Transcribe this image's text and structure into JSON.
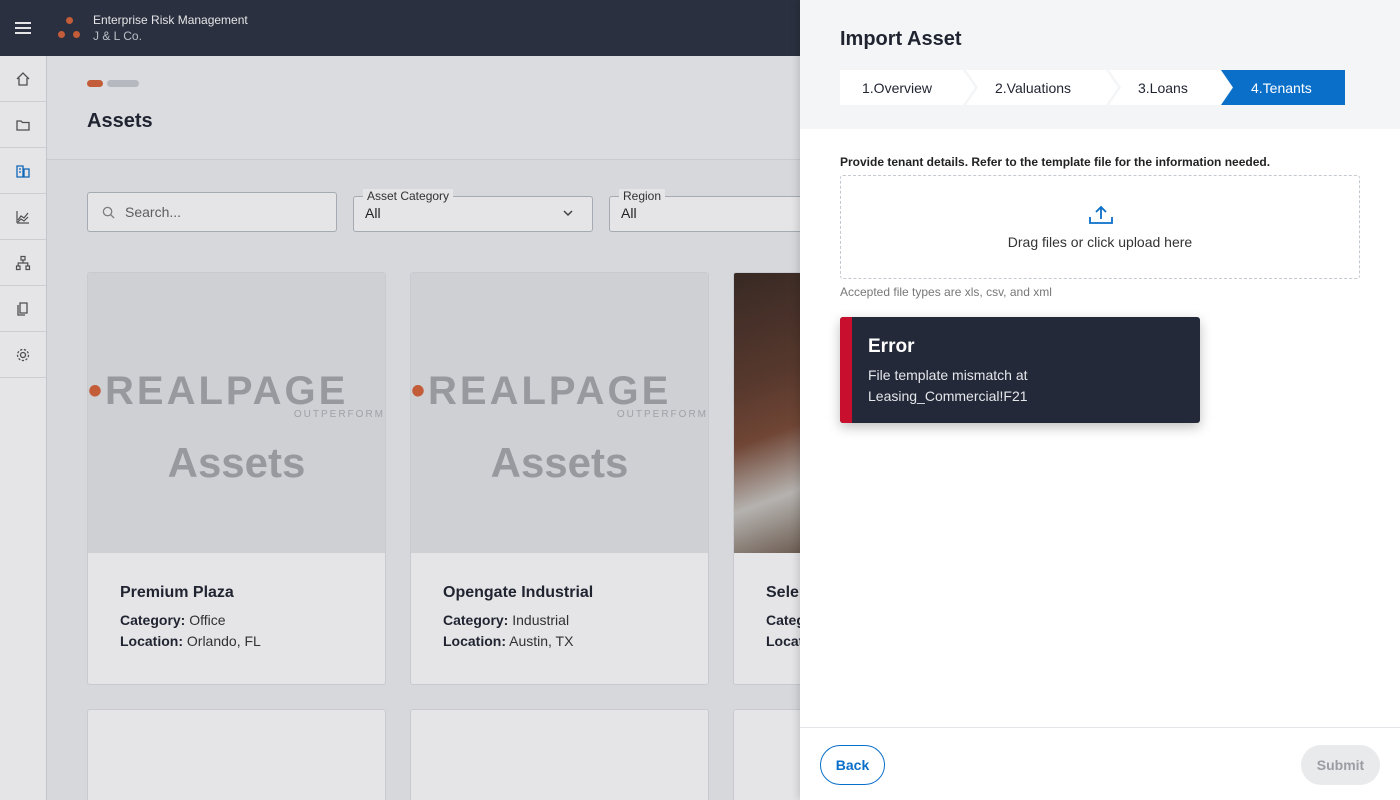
{
  "app": {
    "title": "Enterprise Risk Management",
    "subtitle": "J & L Co."
  },
  "colors": {
    "brand_dot": "#d9633a",
    "primary": "#0a6fc9",
    "error": "#c8102e",
    "topbar": "#2b3240"
  },
  "rail": {
    "icons": [
      "home-icon",
      "folder-icon",
      "assets-icon",
      "chart-icon",
      "hierarchy-icon",
      "documents-icon",
      "gear-icon"
    ]
  },
  "page": {
    "title": "Assets"
  },
  "filters": {
    "search_placeholder": "Search...",
    "asset_category": {
      "label": "Asset Category",
      "value": "All"
    },
    "region": {
      "label": "Region",
      "value": "All"
    }
  },
  "cards": [
    {
      "name": "Premium Plaza",
      "category_label": "Category:",
      "category": "Office",
      "location_label": "Location:",
      "location": "Orlando, FL",
      "image_brand": "REALPAGE",
      "image_sub": "OUTPERFORM",
      "image_caption": "Assets"
    },
    {
      "name": "Opengate Industrial",
      "category_label": "Category:",
      "category": "Industrial",
      "location_label": "Location:",
      "location": "Austin, TX",
      "image_brand": "REALPAGE",
      "image_sub": "OUTPERFORM",
      "image_caption": "Assets"
    },
    {
      "name": "Selen",
      "category_label": "Categ",
      "location_label": "Locat"
    }
  ],
  "drawer": {
    "title": "Import Asset",
    "steps": [
      "1.Overview",
      "2.Valuations",
      "3.Loans",
      "4.Tenants"
    ],
    "active_step": 3,
    "instructions": "Provide tenant details. Refer to the template file for the information needed.",
    "dropzone_text": "Drag files or click upload here",
    "accepted_hint": "Accepted file types are xls, csv, and xml",
    "error": {
      "title": "Error",
      "message": "File template mismatch at Leasing_Commercial!F21"
    },
    "back_label": "Back",
    "submit_label": "Submit"
  }
}
